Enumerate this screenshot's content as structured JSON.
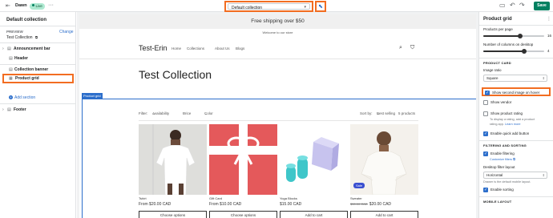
{
  "topbar": {
    "theme_name": "Dawn",
    "live_badge": "Live",
    "template_select": "Default collection",
    "save_label": "Save"
  },
  "left": {
    "title": "Default collection",
    "preview_label": "PREVIEW",
    "preview_value": "Test Collection",
    "change_label": "Change",
    "tree": [
      {
        "label": "Announcement bar"
      },
      {
        "label": "Header"
      },
      {
        "label": "Collection banner"
      },
      {
        "label": "Product grid"
      },
      {
        "label": "Footer"
      }
    ],
    "add_section": "Add section"
  },
  "store": {
    "announcement": "Free shipping over $50",
    "subnote": "Welcome to our store",
    "logo": "Test-Erin",
    "nav": [
      "Home",
      "Collections",
      "About Us",
      "Blogs"
    ],
    "page_title": "Test Collection",
    "section_tag": "Product grid",
    "filters": {
      "filter_label": "Filter:",
      "availability": "Availability",
      "price": "Price",
      "color": "Color",
      "sort_label": "Sort by:",
      "sort_value": "Best selling",
      "count": "5 products"
    },
    "products": [
      {
        "name": "Tshirt",
        "price": "From $20.00 CAD",
        "old_price": "",
        "button": "Choose options",
        "badge": ""
      },
      {
        "name": "Gift Card",
        "price": "From $10.00 CAD",
        "old_price": "",
        "button": "Choose options",
        "badge": ""
      },
      {
        "name": "Yoga Blocks",
        "price": "$15.00 CAD",
        "old_price": "",
        "button": "Add to cart",
        "badge": ""
      },
      {
        "name": "Sweater",
        "price": "$20.00 CAD",
        "old_price": "$30.00 CAD",
        "button": "Add to cart",
        "badge": "Sale"
      }
    ],
    "colors": {
      "gift_card": "#e4595b",
      "yoga_teal": "#3ec6c9",
      "yoga_lilac": "#c7c3ee"
    }
  },
  "right": {
    "title": "Product grid",
    "products_per_page_label": "Products per page",
    "products_per_page_value": "16",
    "products_per_page_fraction": 0.6,
    "columns_label": "Number of columns on desktop",
    "columns_value": "4",
    "columns_fraction": 0.67,
    "product_card_head": "PRODUCT CARD",
    "image_ratio_label": "Image ratio",
    "image_ratio_value": "Square",
    "show_second_image": "Show second image on hover",
    "show_vendor": "Show vendor",
    "show_rating": "Show product rating",
    "rating_help_1": "To display a rating, add a product",
    "rating_help_2": "rating app.",
    "rating_help_link": "Learn more",
    "quick_add": "Enable quick add button",
    "filtering_head": "FILTERING AND SORTING",
    "enable_filtering": "Enable filtering",
    "customize_filters": "Customize filters",
    "desktop_filter_label": "Desktop filter layout",
    "desktop_filter_value": "Horizontal",
    "drawer_note": "Drawer is the default mobile layout.",
    "enable_sorting": "Enable sorting",
    "mobile_head": "MOBILE LAYOUT"
  }
}
